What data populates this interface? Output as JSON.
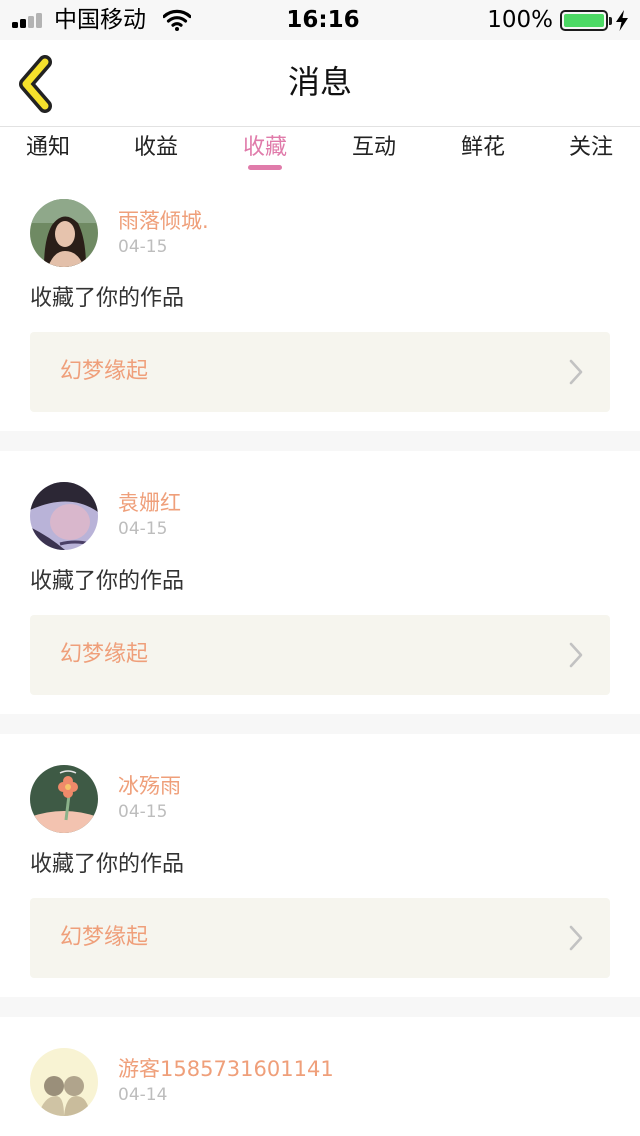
{
  "status_bar": {
    "carrier": "中国移动",
    "time": "16:16",
    "battery": "100%"
  },
  "nav": {
    "title": "消息",
    "back_icon": "chevron-left-icon",
    "back_color": "#f5e12c"
  },
  "tabs": [
    {
      "label": "通知",
      "active": false
    },
    {
      "label": "收益",
      "active": false
    },
    {
      "label": "收藏",
      "active": true
    },
    {
      "label": "互动",
      "active": false
    },
    {
      "label": "鲜花",
      "active": false
    },
    {
      "label": "关注",
      "active": false
    }
  ],
  "feed": [
    {
      "user": "雨落倾城.",
      "date": "04-15",
      "action": "收藏了你的作品",
      "work": "幻梦缘起"
    },
    {
      "user": "袁姗红",
      "date": "04-15",
      "action": "收藏了你的作品",
      "work": "幻梦缘起"
    },
    {
      "user": "冰殇雨",
      "date": "04-15",
      "action": "收藏了你的作品",
      "work": "幻梦缘起"
    },
    {
      "user": "游客1585731601141",
      "date": "04-14"
    }
  ],
  "colors": {
    "accent": "#e07baa",
    "username": "#ef9f7a",
    "work_box_bg": "#f6f5ee"
  }
}
